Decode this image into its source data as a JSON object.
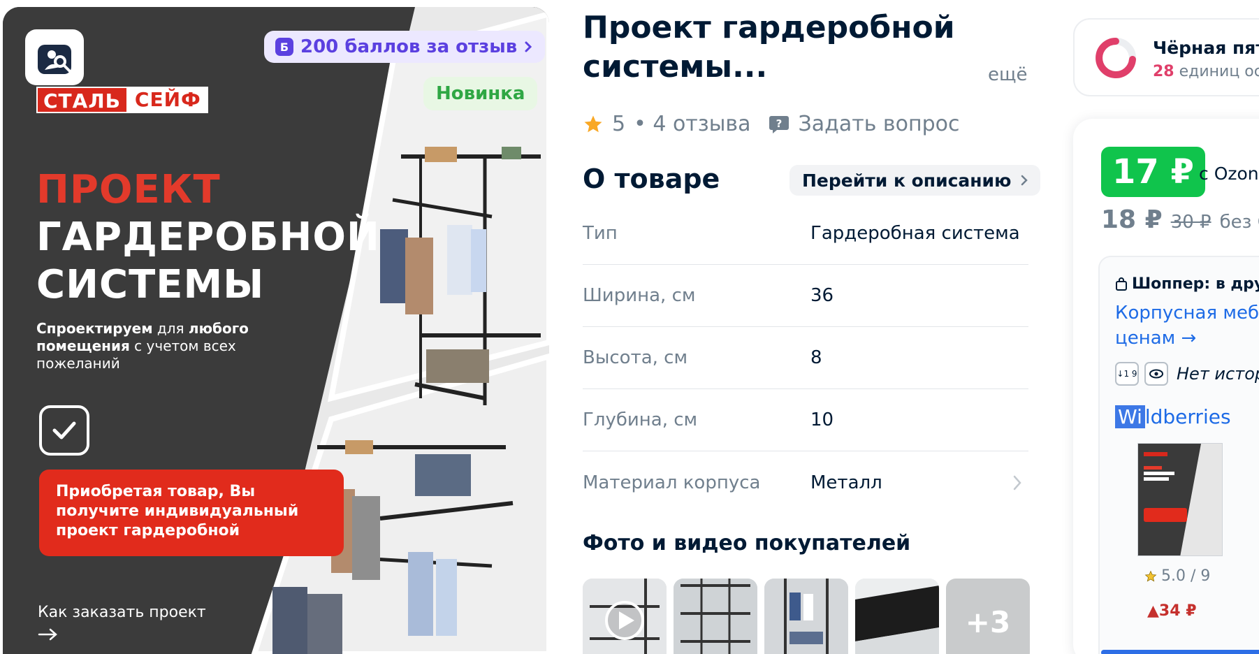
{
  "gallery": {
    "bonus_badge_letter": "Б",
    "bonus_text": "200 баллов за отзыв",
    "new_badge": "Новинка",
    "brand_left": "СТАЛЬ",
    "brand_right": "СЕЙФ",
    "headline_line1": "ПРОЕКТ",
    "headline_line2": "ГАРДЕРОБНОЙ",
    "headline_line3": "СИСТЕМЫ",
    "subline_bold1": "Спроектируем",
    "subline_normal1": " для ",
    "subline_bold2": "любого помещения",
    "subline_normal2": " с учетом всех пожеланий",
    "promo_text": "Приобретая товар, Вы получите индивидуальный проект гардеробной",
    "order_link": "Как заказать проект"
  },
  "product": {
    "title": "Проект гардеробной системы...",
    "more": "ещё",
    "rating": "5",
    "reviews": "• 4 отзыва",
    "ask_question": "Задать вопрос"
  },
  "about": {
    "heading": "О товаре",
    "goto_description": "Перейти к описанию",
    "specs": [
      {
        "key": "Тип",
        "value": "Гардеробная система"
      },
      {
        "key": "Ширина, см",
        "value": "36"
      },
      {
        "key": "Высота, см",
        "value": "8"
      },
      {
        "key": "Глубина, см",
        "value": "10"
      },
      {
        "key": "Материал корпуса",
        "value": "Металл"
      }
    ]
  },
  "photos": {
    "heading": "Фото и видео покупателей",
    "more_count": "+3"
  },
  "seller": {
    "name": "Чёрная пят",
    "count": "28",
    "sub": " единиц ос"
  },
  "price": {
    "main": "17 ₽",
    "main_note": "с Ozon",
    "regular": "18 ₽",
    "old": "30 ₽",
    "regular_note": "без О"
  },
  "shopper": {
    "title": "Шоппер: в дру",
    "link_line1": "Корпусная мебе",
    "link_line2": "ценам →",
    "sort_icon_label": "↓1 9",
    "history": "Нет истор",
    "market_hl": "Wi",
    "market_rest": "ldberries",
    "wb_rating": "5.0 / 9",
    "wb_price": "▲34 ₽"
  },
  "colors": {
    "ozon_green": "#10c44c",
    "link_blue": "#1e6be6",
    "brand_red": "#e12b1c",
    "bonus_purple": "#5b40e0"
  }
}
